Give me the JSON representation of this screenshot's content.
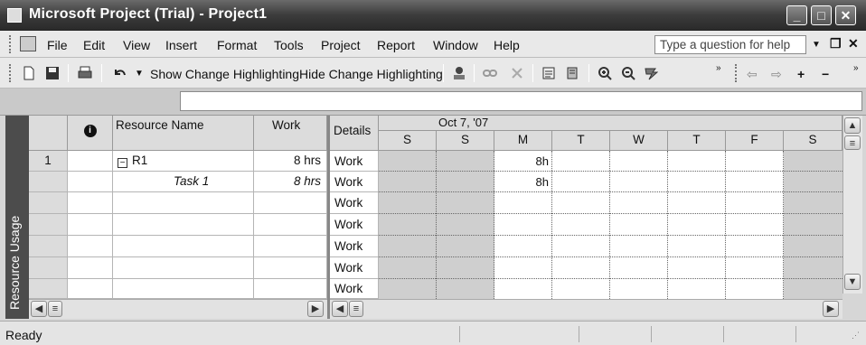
{
  "window": {
    "title": "Microsoft Project (Trial) - Project1"
  },
  "menu": {
    "items": [
      "File",
      "Edit",
      "View",
      "Insert",
      "Format",
      "Tools",
      "Project",
      "Report",
      "Window",
      "Help"
    ],
    "help_placeholder": "Type a question for help"
  },
  "toolbar": {
    "show_change": "Show Change Highlighting",
    "hide_change": "Hide Change Highlighting"
  },
  "viewbar": {
    "label": "Resource Usage"
  },
  "sheet": {
    "columns": [
      "",
      "Resource Name",
      "Work"
    ],
    "info_icon": "info-icon",
    "rows": [
      {
        "id": "1",
        "name": "R1",
        "work": "8 hrs",
        "kind": "resource"
      },
      {
        "id": "",
        "name": "Task 1",
        "work": "8 hrs",
        "kind": "assignment"
      }
    ]
  },
  "timescale": {
    "details_header": "Details",
    "period": "Oct 7, '07",
    "days": [
      "S",
      "S",
      "M",
      "T",
      "W",
      "T",
      "F",
      "S"
    ],
    "detail_label": "Work",
    "rows": [
      [
        "",
        "",
        "8h",
        "",
        "",
        "",
        "",
        ""
      ],
      [
        "",
        "",
        "8h",
        "",
        "",
        "",
        "",
        ""
      ]
    ]
  },
  "status": {
    "text": "Ready"
  },
  "colors": {
    "titlebar": "#3c3c3c",
    "viewbar": "#4c4c4c",
    "nonworking": "#cfcfcf"
  }
}
